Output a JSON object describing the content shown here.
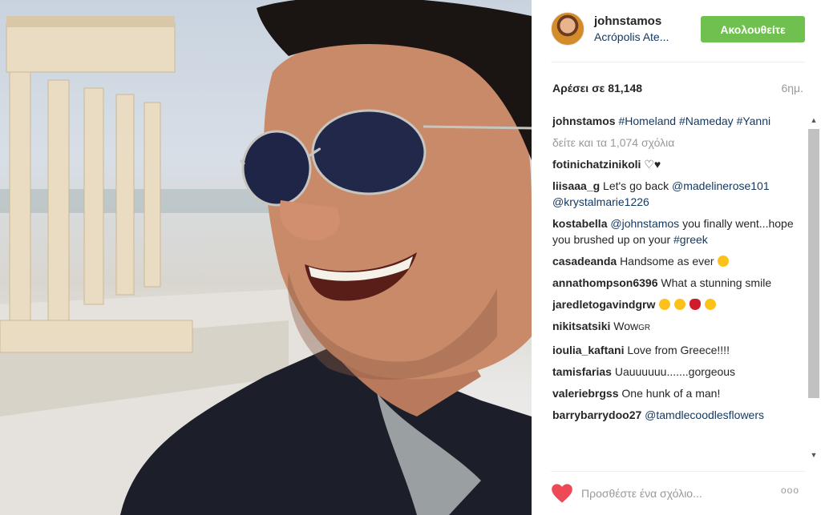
{
  "post": {
    "username": "johnstamos",
    "location": "Acrópolis Ate...",
    "follow_label": "Ακολουθείτε",
    "likes_text": "Αρέσει σε 81,148",
    "time_ago": "6ημ."
  },
  "caption": {
    "user": "johnstamos",
    "tags": [
      "#Homeland",
      "#Nameday",
      "#Yanni"
    ]
  },
  "load_more": "δείτε και τα 1,074 σχόλια",
  "comments": [
    {
      "user": "fotinichatzinikoli",
      "text": "♡♥"
    },
    {
      "user": "liisaaa_g",
      "text": "Let's go back",
      "mentions": [
        "@madelinerose101",
        "@krystalmarie1226"
      ]
    },
    {
      "user": "kostabella",
      "mention": "@johnstamos",
      "text": "you finally went...hope you brushed up on your",
      "tag": "#greek"
    },
    {
      "user": "casadeanda",
      "text": "Handsome as ever"
    },
    {
      "user": "annathompson6396",
      "text": "What a stunning smile"
    },
    {
      "user": "jaredletogavindgrw",
      "text": ""
    },
    {
      "user": "nikitsatsiki",
      "text": "Wow",
      "suffix": "GR"
    },
    {
      "user": "ioulia_kaftani",
      "text": "Love from Greece!!!!"
    },
    {
      "user": "tamisfarias",
      "text": "Uauuuuuu.......gorgeous"
    },
    {
      "user": "valeriebrgss",
      "text": "One hunk of a man!"
    },
    {
      "user": "barrybarrydoo27",
      "text": "@tamdlecoodlesflowers"
    }
  ],
  "footer": {
    "comment_placeholder": "Προσθέστε ένα σχόλιο...",
    "more_label": "ooo"
  },
  "icons": {
    "heart": "heart-icon",
    "more": "more-options-icon",
    "scroll_up": "chevron-up-icon",
    "scroll_down": "chevron-down-icon"
  },
  "colors": {
    "follow_bg": "#70c050",
    "link": "#12375f",
    "heart": "#ed4956",
    "muted": "#999999"
  }
}
